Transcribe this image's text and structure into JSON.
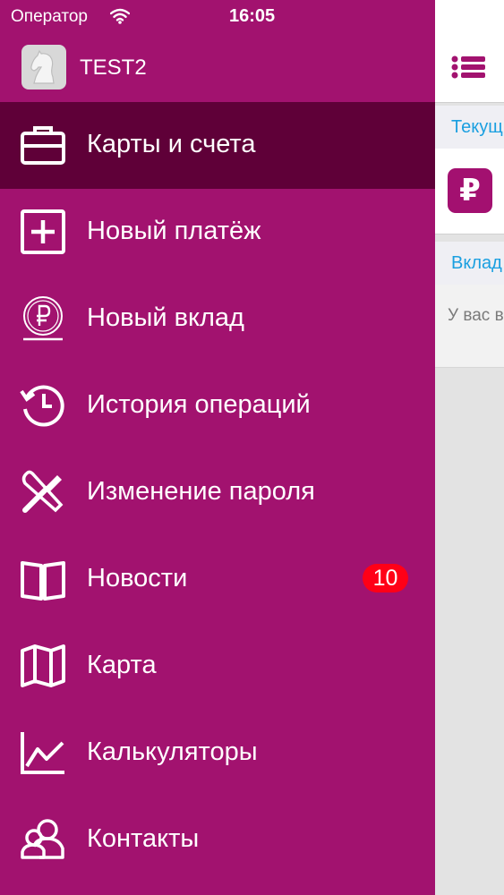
{
  "status_bar": {
    "carrier": "Оператор",
    "time": "16:05"
  },
  "drawer": {
    "user_name": "TEST2",
    "menu": [
      {
        "label": "Карты и счета",
        "icon": "briefcase-icon",
        "active": true
      },
      {
        "label": "Новый платёж",
        "icon": "plus-square-icon"
      },
      {
        "label": "Новый вклад",
        "icon": "ruble-coin-icon"
      },
      {
        "label": "История операций",
        "icon": "history-clock-icon"
      },
      {
        "label": "Изменение пароля",
        "icon": "tools-icon"
      },
      {
        "label": "Новости",
        "icon": "book-icon",
        "badge": "10"
      },
      {
        "label": "Карта",
        "icon": "map-icon"
      },
      {
        "label": "Калькуляторы",
        "icon": "chart-icon"
      },
      {
        "label": "Контакты",
        "icon": "contacts-icon"
      }
    ]
  },
  "content": {
    "tab_current": "Текущ",
    "tab_deposits": "Вклад",
    "empty_text": "У вас вклад"
  },
  "colors": {
    "drawer_bg": "#a2126f",
    "active_item_bg": "#5f0038",
    "badge_bg": "#ff0017",
    "link_blue": "#1a9fe0",
    "rub_tile": "#a31070"
  }
}
